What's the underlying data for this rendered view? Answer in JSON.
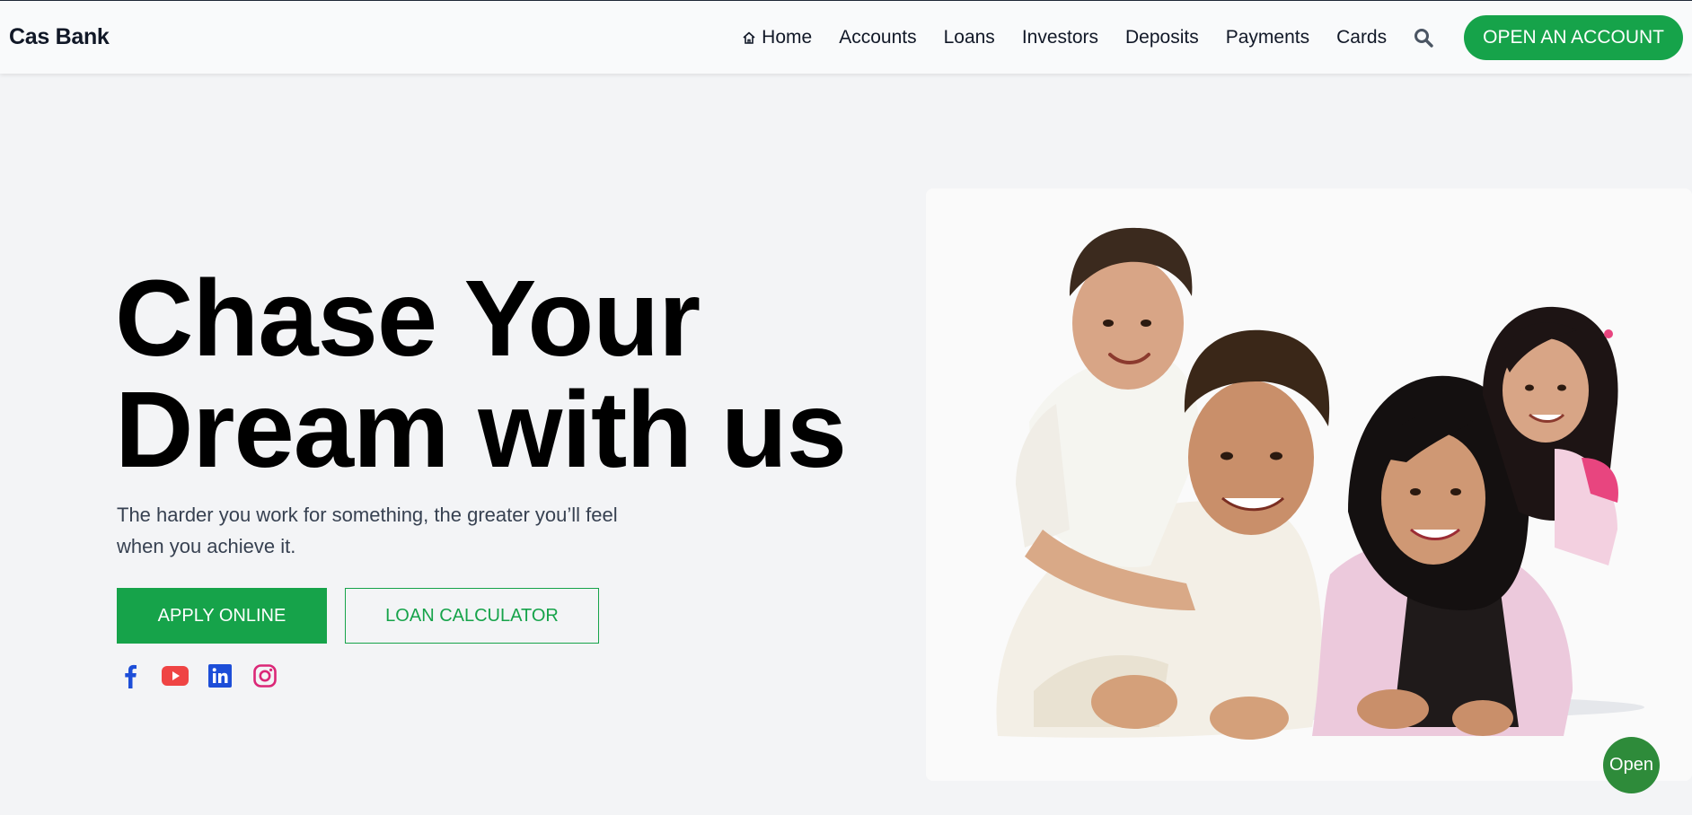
{
  "brand": {
    "name": "Cas Bank"
  },
  "nav": {
    "items": [
      "Home",
      "Accounts",
      "Loans",
      "Investors",
      "Deposits",
      "Payments",
      "Cards"
    ],
    "cta_label": "OPEN AN ACCOUNT"
  },
  "hero": {
    "title_line1": "Chase Your",
    "title_line2": "Dream with us",
    "subtitle": "The harder you work for something, the greater you’ll feel when you achieve it.",
    "primary_button": "APPLY ONLINE",
    "secondary_button": "LOAN CALCULATOR"
  },
  "socials": [
    "facebook-icon",
    "youtube-icon",
    "linkedin-icon",
    "instagram-icon"
  ],
  "colors": {
    "accent": "#16a34a",
    "facebook": "#1d4ed8",
    "youtube": "#ef4444",
    "linkedin": "#1d4ed8",
    "instagram": "#db2777"
  },
  "chat": {
    "label": "Open"
  }
}
